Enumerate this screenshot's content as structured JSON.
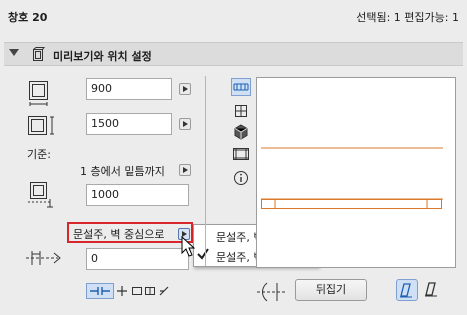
{
  "header": {
    "title": "창호 20",
    "selection": "선택됨: 1 편집가능: 1"
  },
  "section": {
    "title": "미리보기와 위치 설정"
  },
  "fields": {
    "width": "900",
    "height": "1500",
    "sill": "1000",
    "offset": "0"
  },
  "reference": {
    "label": "기준:",
    "value": "1 층에서 밑틈까지"
  },
  "anchor_dropdown": {
    "selected": "문설주, 벽 중심으로",
    "options": [
      {
        "label": "문설주, 벽 면쪽으로",
        "checked": false
      },
      {
        "label": "문설주, 벽 중심으로",
        "checked": true
      }
    ]
  },
  "buttons": {
    "flip": "뒤집기"
  },
  "colors": {
    "accent_blue": "#1e5fb4",
    "highlight_red": "#d8262c",
    "preview_line": "#d9782b"
  },
  "icons": {
    "view_tools": [
      "plan-view-icon",
      "section-grid-icon",
      "3d-view-icon",
      "elevation-view-icon",
      "info-icon"
    ]
  }
}
